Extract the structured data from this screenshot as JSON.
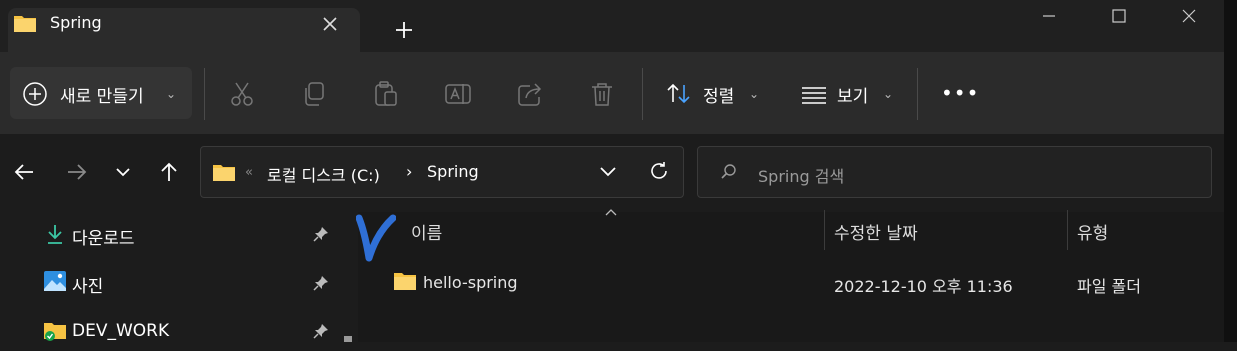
{
  "tab": {
    "title": "Spring"
  },
  "toolbar": {
    "new_label": "새로 만들기",
    "sort_label": "정렬",
    "view_label": "보기",
    "more_label": "•••",
    "chevron": "⌄"
  },
  "address": {
    "overflow": "«",
    "segments": [
      "로컬 디스크 (C:)",
      "Spring"
    ],
    "separator": "›"
  },
  "search": {
    "placeholder": "Spring 검색"
  },
  "sidebar": {
    "items": [
      {
        "label": "다운로드",
        "icon": "download-icon"
      },
      {
        "label": "사진",
        "icon": "pictures-icon"
      },
      {
        "label": "DEV_WORK",
        "icon": "folder-sync-icon"
      }
    ]
  },
  "columns": {
    "name": "이름",
    "modified": "수정한 날짜",
    "type": "유형"
  },
  "rows": [
    {
      "name": "hello-spring",
      "modified": "2022-12-10 오후 11:36",
      "type": "파일 폴더"
    }
  ],
  "colors": {
    "accent": "#2f6fd6",
    "folder": "#f6c343",
    "background": "#1c1c1c"
  }
}
